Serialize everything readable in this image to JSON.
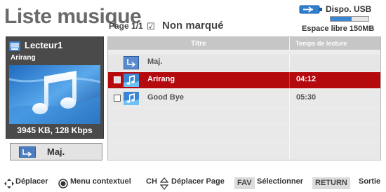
{
  "header": {
    "title": "Liste musique",
    "page": "Page 1/1",
    "mark_filter_symbol": "☑",
    "mark_filter_label": "Non marqué"
  },
  "usb": {
    "label": "Dispo. USB",
    "free_space": "Espace libre 150MB",
    "usage_fraction": 0.55,
    "bar_color": "#3a86d4"
  },
  "player": {
    "name": "Lecteur1",
    "song": "Arirang",
    "file_info": "3945 KB, 128 Kbps",
    "art_icon": "music-note-icon"
  },
  "back_button": {
    "label": "Maj."
  },
  "list": {
    "headers": {
      "title": "Titre",
      "time": "Temps de lecture"
    },
    "rows": [
      {
        "type": "folder",
        "name": "Maj.",
        "time": ""
      },
      {
        "type": "music",
        "name": "Arirang",
        "time": "04:12",
        "selected": true
      },
      {
        "type": "music",
        "name": "Good Bye",
        "time": "05:30",
        "selected": false
      }
    ]
  },
  "footer": {
    "move": "Déplacer",
    "context_menu": "Menu contextuel",
    "ch": "CH",
    "move_page": "Déplacer Page",
    "fav_key": "FAV",
    "select": "Sélectionner",
    "return_key": "RETURN",
    "exit": "Sortie"
  },
  "colors": {
    "selected_row": "#b40a0e",
    "panel_dark": "#4a4a4a",
    "title_grey": "#6a6a6a"
  }
}
